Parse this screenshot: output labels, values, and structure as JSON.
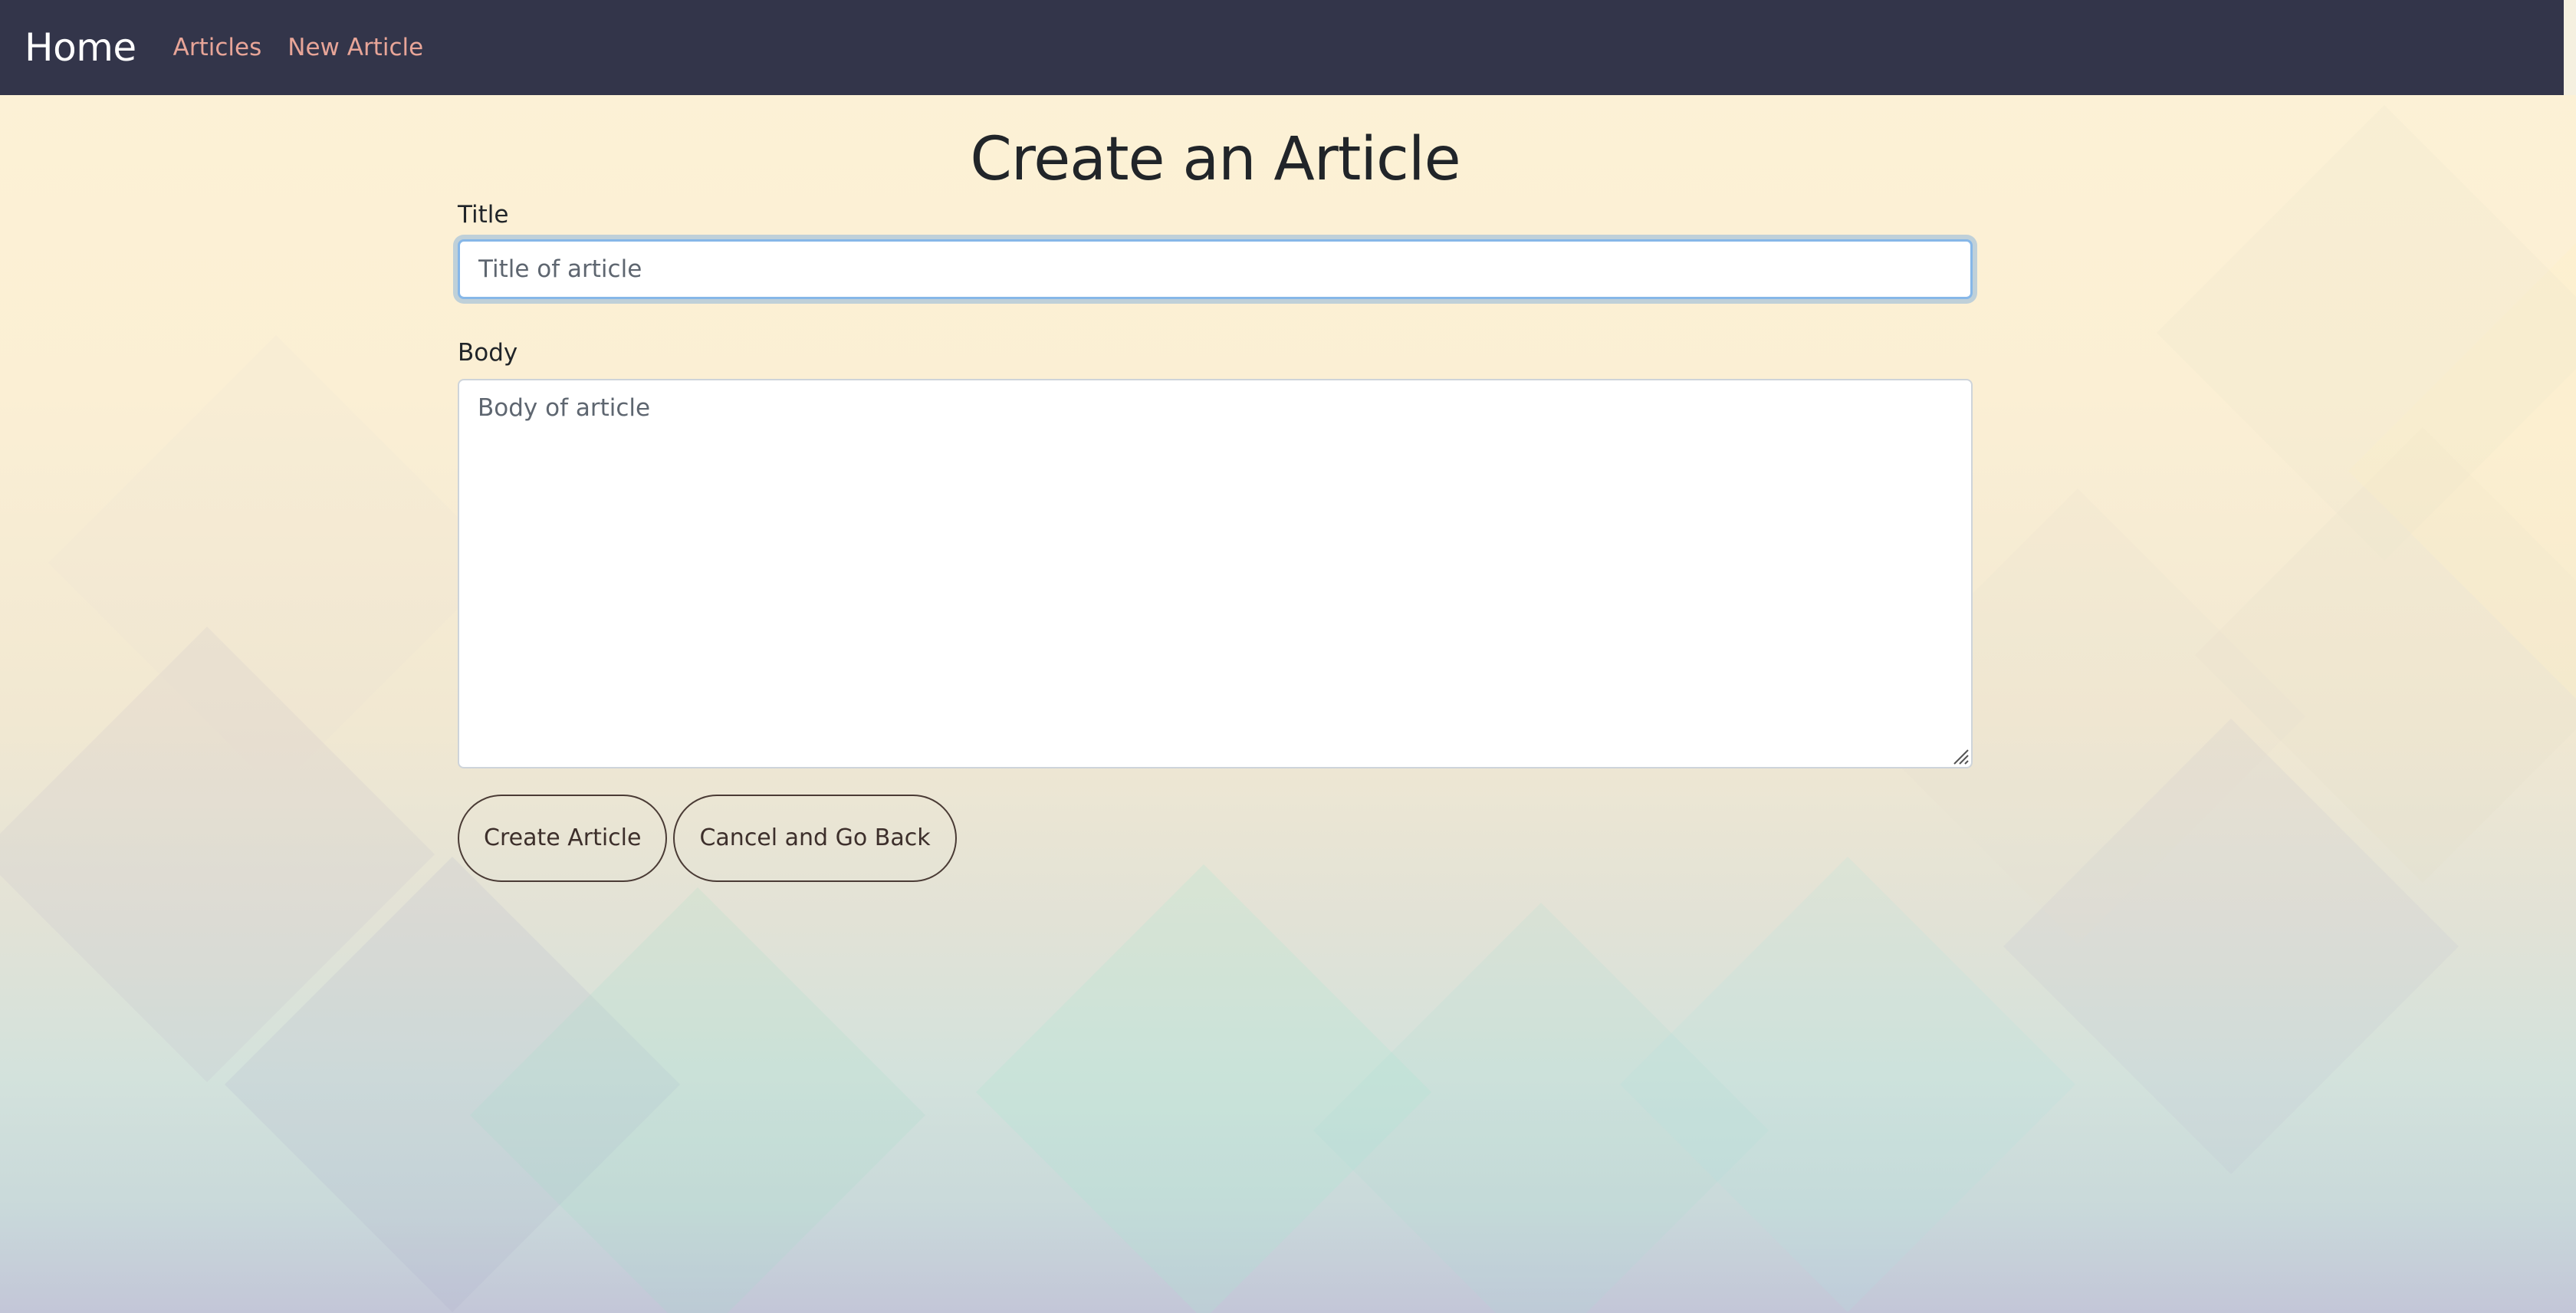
{
  "navbar": {
    "brand": "Home",
    "links": [
      "Articles",
      "New Article"
    ]
  },
  "page": {
    "title": "Create an Article"
  },
  "form": {
    "title_label": "Title",
    "title_placeholder": "Title of article",
    "title_value": "",
    "body_label": "Body",
    "body_placeholder": "Body of article",
    "body_value": "",
    "submit_label": "Create Article",
    "cancel_label": "Cancel and Go Back"
  },
  "colors": {
    "navbar_bg": "#33354a",
    "nav_link": "#e8a598",
    "focus_ring": "#86b7e8"
  }
}
